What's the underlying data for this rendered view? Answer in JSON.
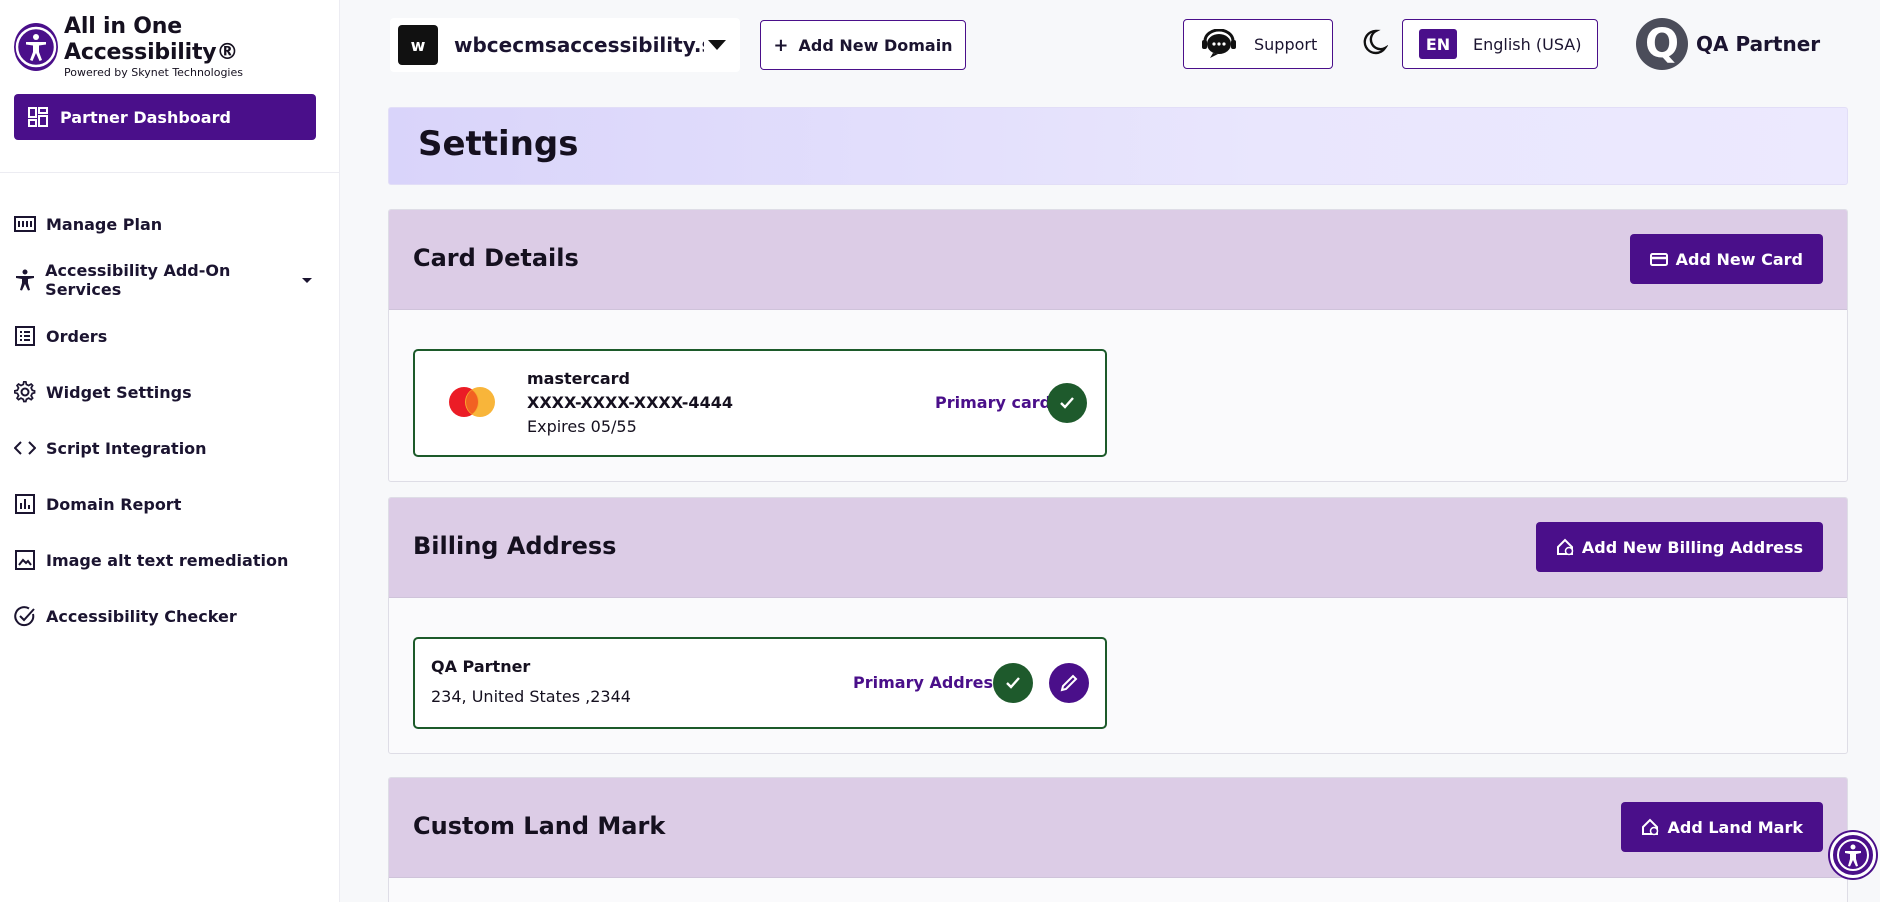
{
  "brand": {
    "title": "All in One Accessibility®",
    "subtitle": "Powered by Skynet Technologies"
  },
  "sidebar": {
    "primary_label": "Partner Dashboard",
    "items": [
      {
        "label": "Manage Plan",
        "icon": "plan-icon"
      },
      {
        "label": "Accessibility Add-On Services",
        "icon": "accessibility-person-icon",
        "has_dropdown": true
      },
      {
        "label": "Orders",
        "icon": "orders-list-icon"
      },
      {
        "label": "Widget Settings",
        "icon": "gear-icon"
      },
      {
        "label": "Script Integration",
        "icon": "code-icon"
      },
      {
        "label": "Domain Report",
        "icon": "bar-chart-icon"
      },
      {
        "label": "Image alt text remediation",
        "icon": "image-icon"
      },
      {
        "label": "Accessibility Checker",
        "icon": "check-circle-icon"
      }
    ]
  },
  "topbar": {
    "domain_initial": "w",
    "domain_name": "wbcecmsaccessibility.sk...",
    "add_domain_label": "Add New Domain",
    "support_label": "Support",
    "lang_code": "EN",
    "lang_label": "English (USA)",
    "user_initial": "Q",
    "user_name": "QA Partner"
  },
  "page": {
    "title": "Settings"
  },
  "card_details": {
    "title": "Card Details",
    "add_button": "Add New Card",
    "card": {
      "brand": "mastercard",
      "number": "XXXX-XXXX-XXXX-4444",
      "expiry": "Expires 05/55",
      "primary_label": "Primary card"
    }
  },
  "billing": {
    "title": "Billing Address",
    "add_button": "Add New Billing Address",
    "address": {
      "name": "QA Partner",
      "line": "234, United States ,2344",
      "primary_label": "Primary Address"
    }
  },
  "landmark": {
    "title": "Custom Land Mark",
    "add_button": "Add Land Mark"
  },
  "colors": {
    "brand_purple": "#4a0f8a",
    "success_green": "#1e5a2c",
    "panel_header": "#dccce6",
    "page_header": "#d9d4fa"
  }
}
